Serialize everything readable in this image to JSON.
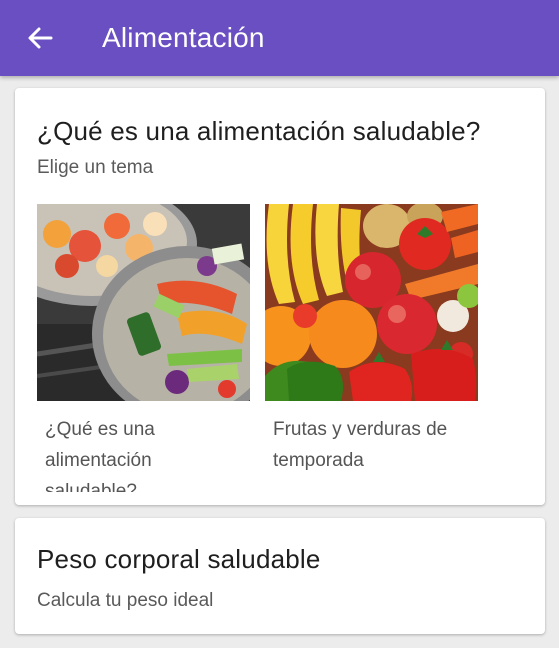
{
  "app_bar": {
    "title": "Alimentación",
    "back_icon": "arrow-left-icon",
    "color": "#6a4fc2"
  },
  "cards": [
    {
      "title": "¿Qué es una alimentación saludable?",
      "subtitle": "Elige un tema",
      "topics": [
        {
          "label": "¿Qué es una alimentación saludable?",
          "image": "cooking-vegetables-pans"
        },
        {
          "label": "Frutas y verduras de temporada",
          "image": "fruits-and-vegetables"
        }
      ]
    },
    {
      "title": "Peso corporal saludable",
      "subtitle": "Calcula tu peso ideal"
    }
  ]
}
